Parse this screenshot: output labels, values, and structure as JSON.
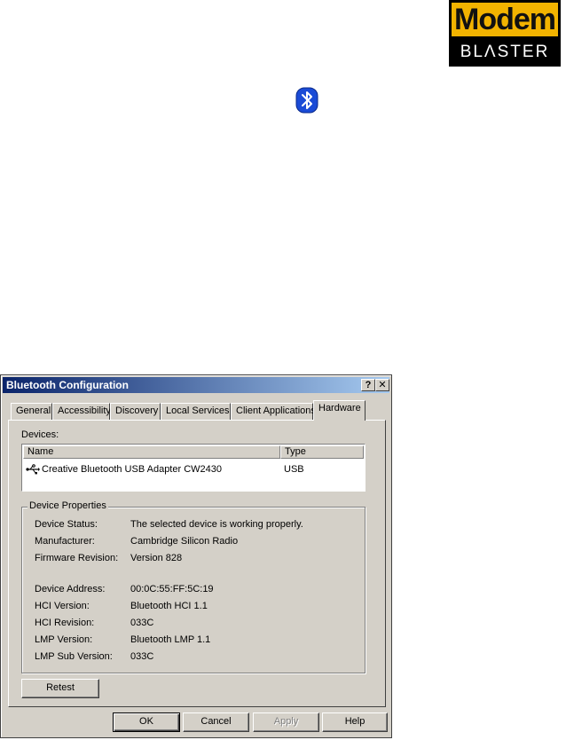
{
  "logo": {
    "top_text": "Modem",
    "bottom_text": "BLΛSTER",
    "colors": {
      "gold": "#f2b300",
      "black": "#000000"
    }
  },
  "bluetooth_icon": {
    "icon": "bluetooth-icon",
    "color": "#1a4bd6"
  },
  "window": {
    "title": "Bluetooth Configuration",
    "help_glyph": "?",
    "close_glyph": "✕",
    "title_gradient": [
      "#0a246a",
      "#a6caf0"
    ]
  },
  "tabs": [
    {
      "label": "General"
    },
    {
      "label": "Accessibility"
    },
    {
      "label": "Discovery"
    },
    {
      "label": "Local Services"
    },
    {
      "label": "Client Applications"
    },
    {
      "label": "Hardware",
      "active": true
    }
  ],
  "hardware": {
    "devices_label": "Devices:",
    "columns": {
      "name": "Name",
      "type": "Type"
    },
    "rows": [
      {
        "name": "Creative Bluetooth USB Adapter CW2430",
        "type": "USB",
        "icon": "usb-icon"
      }
    ],
    "properties_title": "Device Properties",
    "properties": [
      {
        "label": "Device Status:",
        "value": "The selected device is working properly."
      },
      {
        "label": "Manufacturer:",
        "value": "Cambridge Silicon Radio"
      },
      {
        "label": "Firmware Revision:",
        "value": "Version 828"
      },
      {
        "label": "Device Address:",
        "value": "00:0C:55:FF:5C:19"
      },
      {
        "label": "HCI Version:",
        "value": "Bluetooth HCI 1.1"
      },
      {
        "label": "HCI Revision:",
        "value": "033C"
      },
      {
        "label": "LMP Version:",
        "value": "Bluetooth LMP 1.1"
      },
      {
        "label": "LMP Sub Version:",
        "value": "033C"
      }
    ],
    "retest_label": "Retest"
  },
  "buttons": {
    "ok": "OK",
    "cancel": "Cancel",
    "apply": "Apply",
    "help": "Help"
  }
}
